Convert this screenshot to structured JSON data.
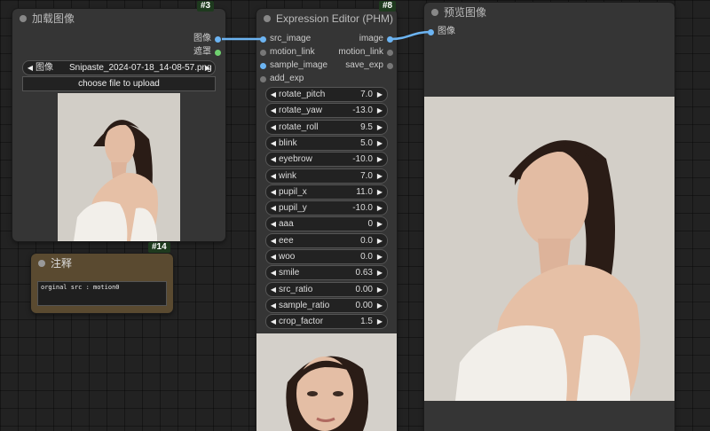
{
  "colors": {
    "link": "#6cb4f2",
    "image_socket": "#6cb4f2",
    "mask_socket": "#6fd06f",
    "note_bg": "#5a4a30",
    "badge_bg": "#1e3a1e"
  },
  "load_node": {
    "badge": "#3",
    "title": "加载图像",
    "outputs": [
      "图像",
      "遮罩"
    ],
    "image_prev_label": "◀",
    "image_label": "图像",
    "image_value": "Snipaste_2024-07-18_14-08-57.png",
    "image_next_label": "▶",
    "upload_button": "choose file to upload",
    "preview_alt": "woman portrait preview"
  },
  "note_node": {
    "badge": "#14",
    "title": "注释",
    "text": "orginal src : motion0"
  },
  "expr_node": {
    "badge": "#8",
    "title": "Expression Editor (PHM)",
    "inputs": [
      "src_image",
      "motion_link",
      "sample_image",
      "add_exp"
    ],
    "outputs": [
      "image",
      "motion_link",
      "save_exp"
    ],
    "params": [
      {
        "label": "rotate_pitch",
        "value": "7.0"
      },
      {
        "label": "rotate_yaw",
        "value": "-13.0"
      },
      {
        "label": "rotate_roll",
        "value": "9.5"
      },
      {
        "label": "blink",
        "value": "5.0"
      },
      {
        "label": "eyebrow",
        "value": "-10.0"
      },
      {
        "label": "wink",
        "value": "7.0"
      },
      {
        "label": "pupil_x",
        "value": "11.0"
      },
      {
        "label": "pupil_y",
        "value": "-10.0"
      },
      {
        "label": "aaa",
        "value": "0"
      },
      {
        "label": "eee",
        "value": "0.0"
      },
      {
        "label": "woo",
        "value": "0.0"
      },
      {
        "label": "smile",
        "value": "0.63"
      },
      {
        "label": "src_ratio",
        "value": "0.00"
      },
      {
        "label": "sample_ratio",
        "value": "0.00"
      },
      {
        "label": "crop_factor",
        "value": "1.5"
      }
    ]
  },
  "preview_node": {
    "title": "预览图像",
    "inputs": [
      "图像"
    ]
  }
}
